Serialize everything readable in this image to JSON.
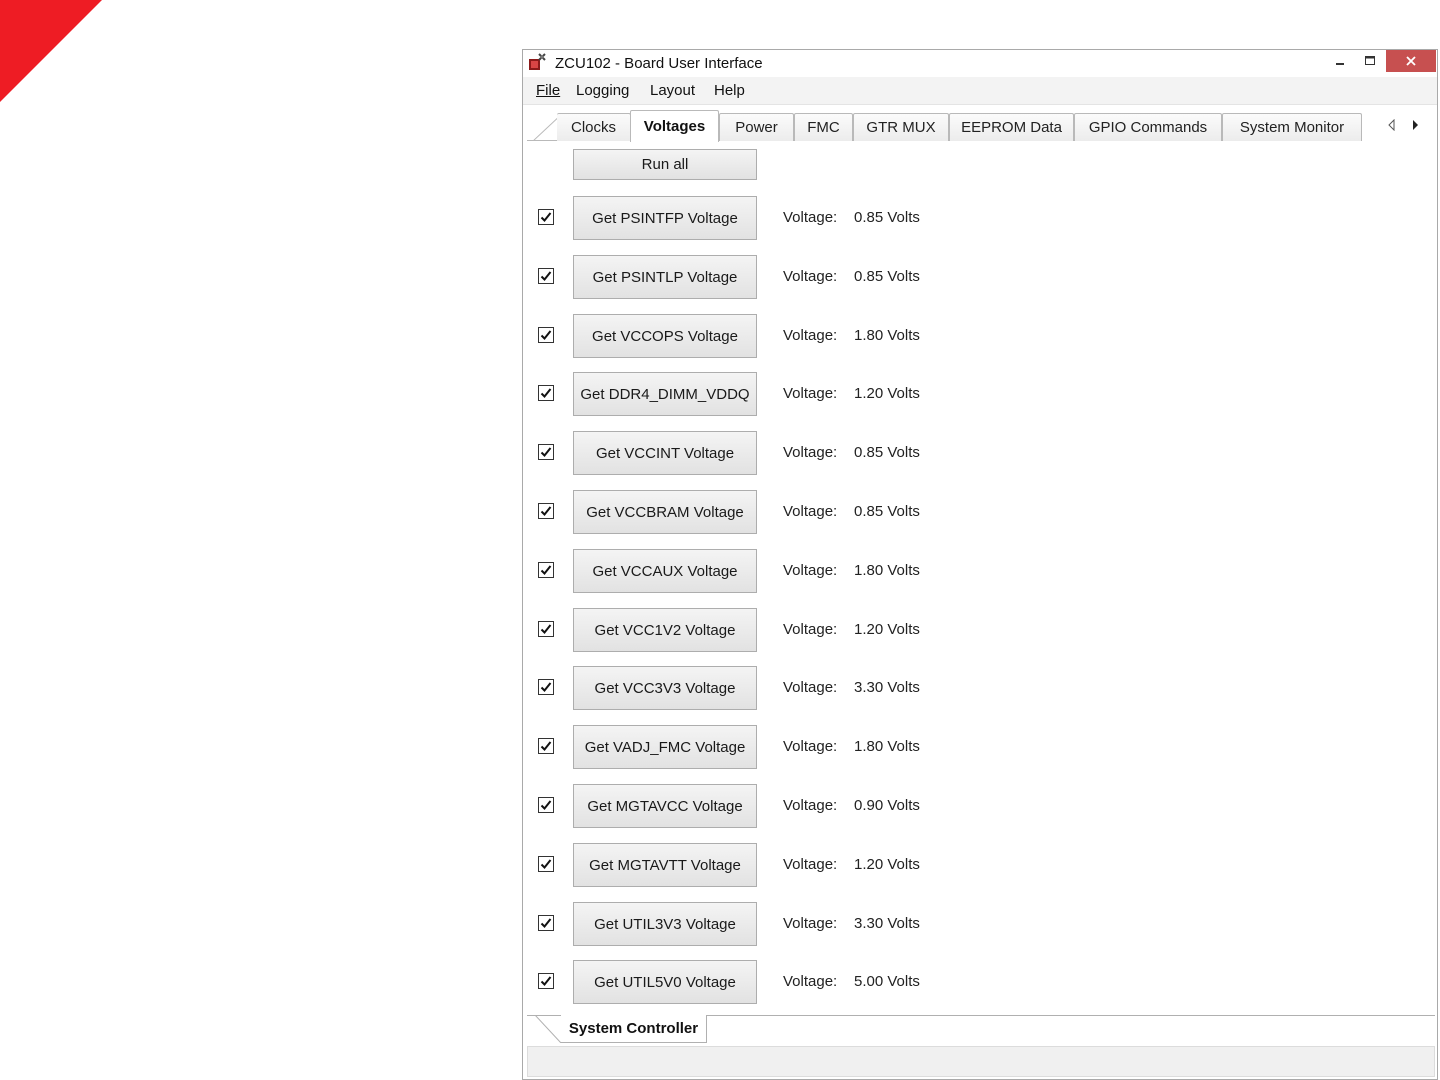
{
  "window": {
    "title": "ZCU102 - Board User Interface"
  },
  "menu": [
    {
      "label": "File"
    },
    {
      "label": "Logging"
    },
    {
      "label": "Layout"
    },
    {
      "label": "Help"
    }
  ],
  "tabs": [
    {
      "label": "Clocks",
      "active": false
    },
    {
      "label": "Voltages",
      "active": true
    },
    {
      "label": "Power",
      "active": false
    },
    {
      "label": "FMC",
      "active": false
    },
    {
      "label": "GTR MUX",
      "active": false
    },
    {
      "label": "EEPROM Data",
      "active": false
    },
    {
      "label": "GPIO Commands",
      "active": false
    },
    {
      "label": "System Monitor",
      "active": false
    }
  ],
  "run_all_label": "Run all",
  "voltage_label": "Voltage:",
  "rows": [
    {
      "button": "Get PSINTFP Voltage",
      "checked": true,
      "value": "0.85 Volts"
    },
    {
      "button": "Get PSINTLP Voltage",
      "checked": true,
      "value": "0.85 Volts"
    },
    {
      "button": "Get VCCOPS Voltage",
      "checked": true,
      "value": "1.80 Volts"
    },
    {
      "button": "Get DDR4_DIMM_VDDQ",
      "checked": true,
      "value": "1.20 Volts"
    },
    {
      "button": "Get VCCINT Voltage",
      "checked": true,
      "value": "0.85 Volts"
    },
    {
      "button": "Get VCCBRAM Voltage",
      "checked": true,
      "value": "0.85 Volts"
    },
    {
      "button": "Get VCCAUX Voltage",
      "checked": true,
      "value": "1.80 Volts"
    },
    {
      "button": "Get VCC1V2 Voltage",
      "checked": true,
      "value": "1.20 Volts"
    },
    {
      "button": "Get VCC3V3 Voltage",
      "checked": true,
      "value": "3.30 Volts"
    },
    {
      "button": "Get VADJ_FMC Voltage",
      "checked": true,
      "value": "1.80 Volts"
    },
    {
      "button": "Get MGTAVCC Voltage",
      "checked": true,
      "value": "0.90 Volts"
    },
    {
      "button": "Get MGTAVTT Voltage",
      "checked": true,
      "value": "1.20 Volts"
    },
    {
      "button": "Get UTIL3V3 Voltage",
      "checked": true,
      "value": "3.30 Volts"
    },
    {
      "button": "Get UTIL5V0 Voltage",
      "checked": true,
      "value": "5.00 Volts"
    }
  ],
  "bottom_tab": "System Controller",
  "colors": {
    "accent_red": "#ee1c24",
    "close_button": "#c75050"
  },
  "icons": {
    "app": "board-ui-app-icon",
    "minimize": "minimize-icon",
    "maximize": "maximize-icon",
    "close": "close-icon",
    "tab_left": "arrow-left-icon",
    "tab_right": "arrow-right-icon",
    "checkbox": "checkmark-icon"
  }
}
